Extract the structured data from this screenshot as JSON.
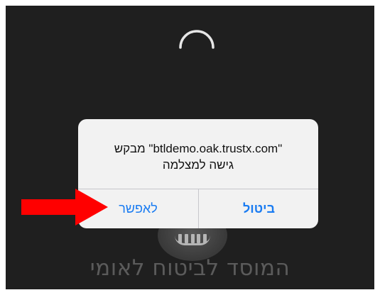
{
  "dialog": {
    "message_line1": "\"btldemo.oak.trustx.com\" מבקש",
    "message_line2": "גישה למצלמה",
    "allow_label": "לאפשר",
    "cancel_label": "ביטול"
  },
  "background": {
    "brand_name": "המוסד לביטוח לאומי",
    "loading_icon": "spinner-icon",
    "emblem_icon": "organization-emblem-icon"
  },
  "colors": {
    "screen_background": "#1f1f1f",
    "dialog_background": "#f2f2f2",
    "button_text": "#1a7cf2",
    "arrow": "#ff0000"
  }
}
